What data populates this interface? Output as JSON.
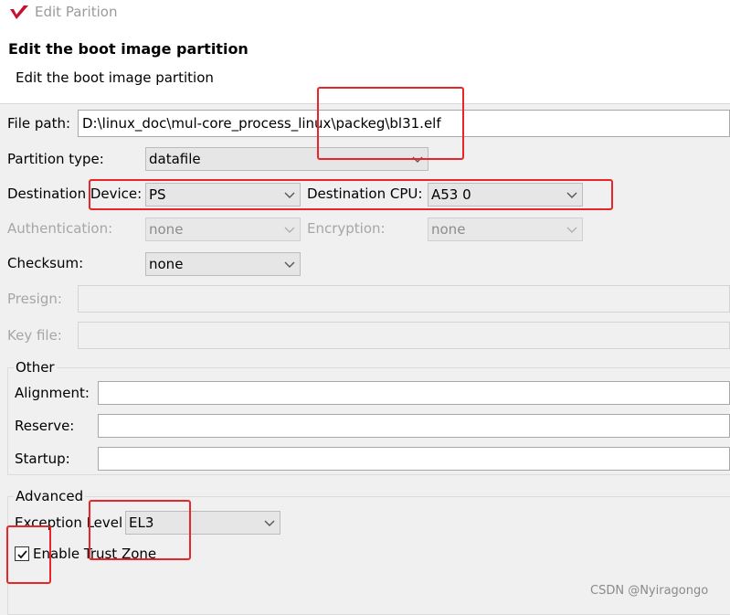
{
  "window": {
    "title": "Edit Parition"
  },
  "header": {
    "title": "Edit the boot image partition",
    "subtitle": "Edit the boot image partition"
  },
  "form": {
    "file_path": {
      "label": "File path:",
      "value": "D:\\linux_doc\\mul-core_process_linux\\packeg\\bl31.elf"
    },
    "partition_type": {
      "label": "Partition type:",
      "value": "datafile"
    },
    "destination_device": {
      "label": "Destination Device:",
      "value": "PS"
    },
    "destination_cpu": {
      "label": "Destination CPU:",
      "value": "A53 0"
    },
    "authentication": {
      "label": "Authentication:",
      "value": "none"
    },
    "encryption": {
      "label": "Encryption:",
      "value": "none"
    },
    "checksum": {
      "label": "Checksum:",
      "value": "none"
    },
    "presign": {
      "label": "Presign:",
      "value": ""
    },
    "key_file": {
      "label": "Key file:",
      "value": ""
    }
  },
  "other": {
    "title": "Other",
    "alignment": {
      "label": "Alignment:",
      "value": ""
    },
    "reserve": {
      "label": "Reserve:",
      "value": ""
    },
    "startup": {
      "label": "Startup:",
      "value": ""
    }
  },
  "advanced": {
    "title": "Advanced",
    "exception_level": {
      "label": "Exception Level",
      "value": "EL3"
    },
    "trust_zone": {
      "label": "Enable Trust Zone",
      "checked": true
    }
  },
  "watermark": "CSDN @Nyiragongo",
  "colors": {
    "annotation_red": "#e8262a",
    "logo_red": "#c8102e"
  },
  "icons": {
    "app_logo": "vivado-logo-icon",
    "chevron": "chevron-down-icon",
    "check": "checkmark-icon"
  }
}
